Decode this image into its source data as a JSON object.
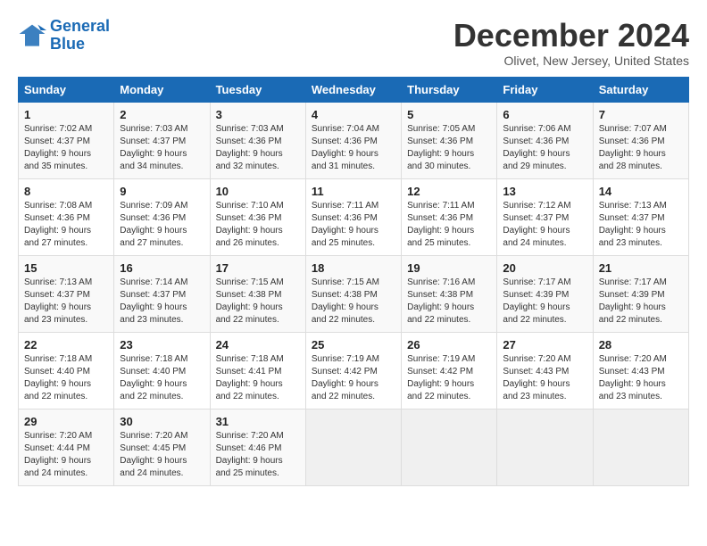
{
  "header": {
    "logo_line1": "General",
    "logo_line2": "Blue",
    "month_title": "December 2024",
    "location": "Olivet, New Jersey, United States"
  },
  "weekdays": [
    "Sunday",
    "Monday",
    "Tuesday",
    "Wednesday",
    "Thursday",
    "Friday",
    "Saturday"
  ],
  "weeks": [
    [
      {
        "day": "1",
        "sunrise": "7:02 AM",
        "sunset": "4:37 PM",
        "daylight": "9 hours and 35 minutes."
      },
      {
        "day": "2",
        "sunrise": "7:03 AM",
        "sunset": "4:37 PM",
        "daylight": "9 hours and 34 minutes."
      },
      {
        "day": "3",
        "sunrise": "7:03 AM",
        "sunset": "4:36 PM",
        "daylight": "9 hours and 32 minutes."
      },
      {
        "day": "4",
        "sunrise": "7:04 AM",
        "sunset": "4:36 PM",
        "daylight": "9 hours and 31 minutes."
      },
      {
        "day": "5",
        "sunrise": "7:05 AM",
        "sunset": "4:36 PM",
        "daylight": "9 hours and 30 minutes."
      },
      {
        "day": "6",
        "sunrise": "7:06 AM",
        "sunset": "4:36 PM",
        "daylight": "9 hours and 29 minutes."
      },
      {
        "day": "7",
        "sunrise": "7:07 AM",
        "sunset": "4:36 PM",
        "daylight": "9 hours and 28 minutes."
      }
    ],
    [
      {
        "day": "8",
        "sunrise": "7:08 AM",
        "sunset": "4:36 PM",
        "daylight": "9 hours and 27 minutes."
      },
      {
        "day": "9",
        "sunrise": "7:09 AM",
        "sunset": "4:36 PM",
        "daylight": "9 hours and 27 minutes."
      },
      {
        "day": "10",
        "sunrise": "7:10 AM",
        "sunset": "4:36 PM",
        "daylight": "9 hours and 26 minutes."
      },
      {
        "day": "11",
        "sunrise": "7:11 AM",
        "sunset": "4:36 PM",
        "daylight": "9 hours and 25 minutes."
      },
      {
        "day": "12",
        "sunrise": "7:11 AM",
        "sunset": "4:36 PM",
        "daylight": "9 hours and 25 minutes."
      },
      {
        "day": "13",
        "sunrise": "7:12 AM",
        "sunset": "4:37 PM",
        "daylight": "9 hours and 24 minutes."
      },
      {
        "day": "14",
        "sunrise": "7:13 AM",
        "sunset": "4:37 PM",
        "daylight": "9 hours and 23 minutes."
      }
    ],
    [
      {
        "day": "15",
        "sunrise": "7:13 AM",
        "sunset": "4:37 PM",
        "daylight": "9 hours and 23 minutes."
      },
      {
        "day": "16",
        "sunrise": "7:14 AM",
        "sunset": "4:37 PM",
        "daylight": "9 hours and 23 minutes."
      },
      {
        "day": "17",
        "sunrise": "7:15 AM",
        "sunset": "4:38 PM",
        "daylight": "9 hours and 22 minutes."
      },
      {
        "day": "18",
        "sunrise": "7:15 AM",
        "sunset": "4:38 PM",
        "daylight": "9 hours and 22 minutes."
      },
      {
        "day": "19",
        "sunrise": "7:16 AM",
        "sunset": "4:38 PM",
        "daylight": "9 hours and 22 minutes."
      },
      {
        "day": "20",
        "sunrise": "7:17 AM",
        "sunset": "4:39 PM",
        "daylight": "9 hours and 22 minutes."
      },
      {
        "day": "21",
        "sunrise": "7:17 AM",
        "sunset": "4:39 PM",
        "daylight": "9 hours and 22 minutes."
      }
    ],
    [
      {
        "day": "22",
        "sunrise": "7:18 AM",
        "sunset": "4:40 PM",
        "daylight": "9 hours and 22 minutes."
      },
      {
        "day": "23",
        "sunrise": "7:18 AM",
        "sunset": "4:40 PM",
        "daylight": "9 hours and 22 minutes."
      },
      {
        "day": "24",
        "sunrise": "7:18 AM",
        "sunset": "4:41 PM",
        "daylight": "9 hours and 22 minutes."
      },
      {
        "day": "25",
        "sunrise": "7:19 AM",
        "sunset": "4:42 PM",
        "daylight": "9 hours and 22 minutes."
      },
      {
        "day": "26",
        "sunrise": "7:19 AM",
        "sunset": "4:42 PM",
        "daylight": "9 hours and 22 minutes."
      },
      {
        "day": "27",
        "sunrise": "7:20 AM",
        "sunset": "4:43 PM",
        "daylight": "9 hours and 23 minutes."
      },
      {
        "day": "28",
        "sunrise": "7:20 AM",
        "sunset": "4:43 PM",
        "daylight": "9 hours and 23 minutes."
      }
    ],
    [
      {
        "day": "29",
        "sunrise": "7:20 AM",
        "sunset": "4:44 PM",
        "daylight": "9 hours and 24 minutes."
      },
      {
        "day": "30",
        "sunrise": "7:20 AM",
        "sunset": "4:45 PM",
        "daylight": "9 hours and 24 minutes."
      },
      {
        "day": "31",
        "sunrise": "7:20 AM",
        "sunset": "4:46 PM",
        "daylight": "9 hours and 25 minutes."
      },
      null,
      null,
      null,
      null
    ]
  ]
}
